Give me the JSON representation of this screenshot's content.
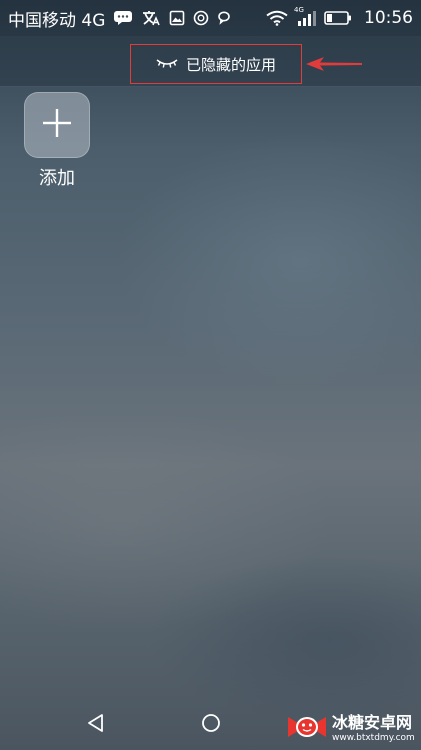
{
  "status_bar": {
    "carrier": "中国移动 4G",
    "network_badge": "4G",
    "time": "10:56",
    "icons": [
      "message-icon",
      "translate-icon",
      "image-icon",
      "app-icon",
      "chat-icon",
      "wifi-icon",
      "signal-icon",
      "battery-icon"
    ]
  },
  "header": {
    "title": "已隐藏的应用",
    "icon": "eye-closed-icon",
    "annotation_color": "#e23b3b"
  },
  "add_tile": {
    "label": "添加",
    "icon": "plus-icon"
  },
  "nav": {
    "icons": [
      "back-icon",
      "home-icon"
    ]
  },
  "watermark": {
    "name": "冰糖安卓网",
    "url": "www.btxtdmy.com",
    "icon": "candy-logo-icon",
    "brand_color": "#e8352f"
  }
}
